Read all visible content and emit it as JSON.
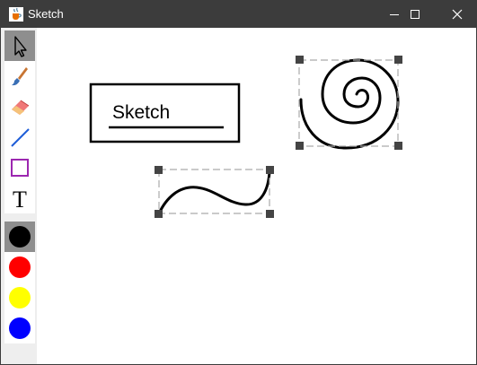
{
  "window": {
    "title": "Sketch",
    "app_icon": "java-cup-icon",
    "controls": [
      "minimize-icon",
      "maximize-icon",
      "close-icon"
    ]
  },
  "toolbar": {
    "tools": [
      {
        "id": "select",
        "icon": "arrow-cursor-icon",
        "selected": true
      },
      {
        "id": "brush",
        "icon": "paintbrush-icon",
        "selected": false
      },
      {
        "id": "eraser",
        "icon": "eraser-icon",
        "selected": false
      },
      {
        "id": "line",
        "icon": "line-icon",
        "selected": false
      },
      {
        "id": "rectangle",
        "icon": "rectangle-icon",
        "selected": false
      },
      {
        "id": "text",
        "icon": "text-icon",
        "label": "T",
        "selected": false
      }
    ],
    "colors": [
      {
        "name": "black",
        "hex": "#000000",
        "selected": true
      },
      {
        "name": "red",
        "hex": "#ff0000",
        "selected": false
      },
      {
        "name": "yellow",
        "hex": "#ffff00",
        "selected": false
      },
      {
        "name": "blue",
        "hex": "#0000ff",
        "selected": false
      }
    ]
  },
  "canvas": {
    "shapes": [
      {
        "type": "rectangle",
        "selected": false
      },
      {
        "type": "text",
        "text": "Sketch",
        "selected": false
      },
      {
        "type": "freehand-underline",
        "selected": false
      },
      {
        "type": "freehand-spiral",
        "selected": true
      },
      {
        "type": "freehand-wave",
        "selected": true
      }
    ]
  },
  "colors": {
    "titlebar": "#3c3c3c",
    "selected_tool_bg": "#8e8e8e",
    "toolbar_bg": "#eeeeee",
    "selection_dash": "#aaaaaa",
    "handle": "#444444"
  }
}
